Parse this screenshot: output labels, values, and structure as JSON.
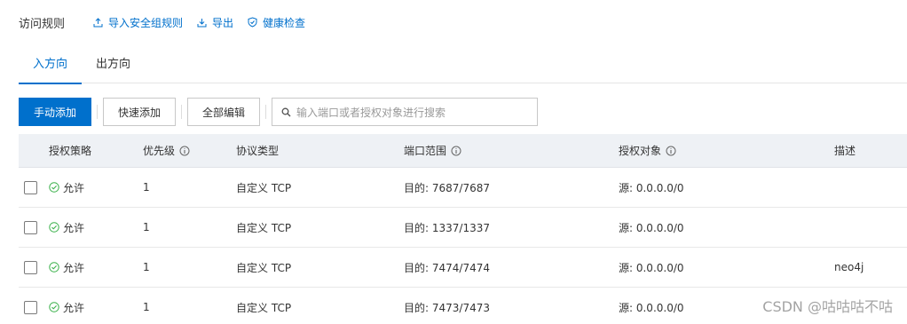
{
  "header": {
    "title": "访问规则",
    "actions": [
      {
        "label": "导入安全组规则",
        "icon": "upload-icon"
      },
      {
        "label": "导出",
        "icon": "download-icon"
      },
      {
        "label": "健康检查",
        "icon": "shield-check-icon"
      }
    ]
  },
  "tabs": [
    {
      "label": "入方向",
      "active": true
    },
    {
      "label": "出方向",
      "active": false
    }
  ],
  "toolbar": {
    "manual_add": "手动添加",
    "quick_add": "快速添加",
    "edit_all": "全部编辑",
    "search_placeholder": "输入端口或者授权对象进行搜索"
  },
  "table": {
    "columns": [
      "授权策略",
      "优先级",
      "协议类型",
      "端口范围",
      "授权对象",
      "描述"
    ],
    "rows": [
      {
        "policy": "允许",
        "priority": "1",
        "protocol": "自定义 TCP",
        "port": "目的: 7687/7687",
        "source": "源: 0.0.0.0/0",
        "desc": ""
      },
      {
        "policy": "允许",
        "priority": "1",
        "protocol": "自定义 TCP",
        "port": "目的: 1337/1337",
        "source": "源: 0.0.0.0/0",
        "desc": ""
      },
      {
        "policy": "允许",
        "priority": "1",
        "protocol": "自定义 TCP",
        "port": "目的: 7474/7474",
        "source": "源: 0.0.0.0/0",
        "desc": "neo4j"
      },
      {
        "policy": "允许",
        "priority": "1",
        "protocol": "自定义 TCP",
        "port": "目的: 7473/7473",
        "source": "源: 0.0.0.0/0",
        "desc": ""
      }
    ]
  },
  "watermark": "CSDN @咕咕咕不咕",
  "colors": {
    "accent": "#0070cc",
    "allow": "#3fb34f",
    "header_bg": "#eef1f5"
  }
}
